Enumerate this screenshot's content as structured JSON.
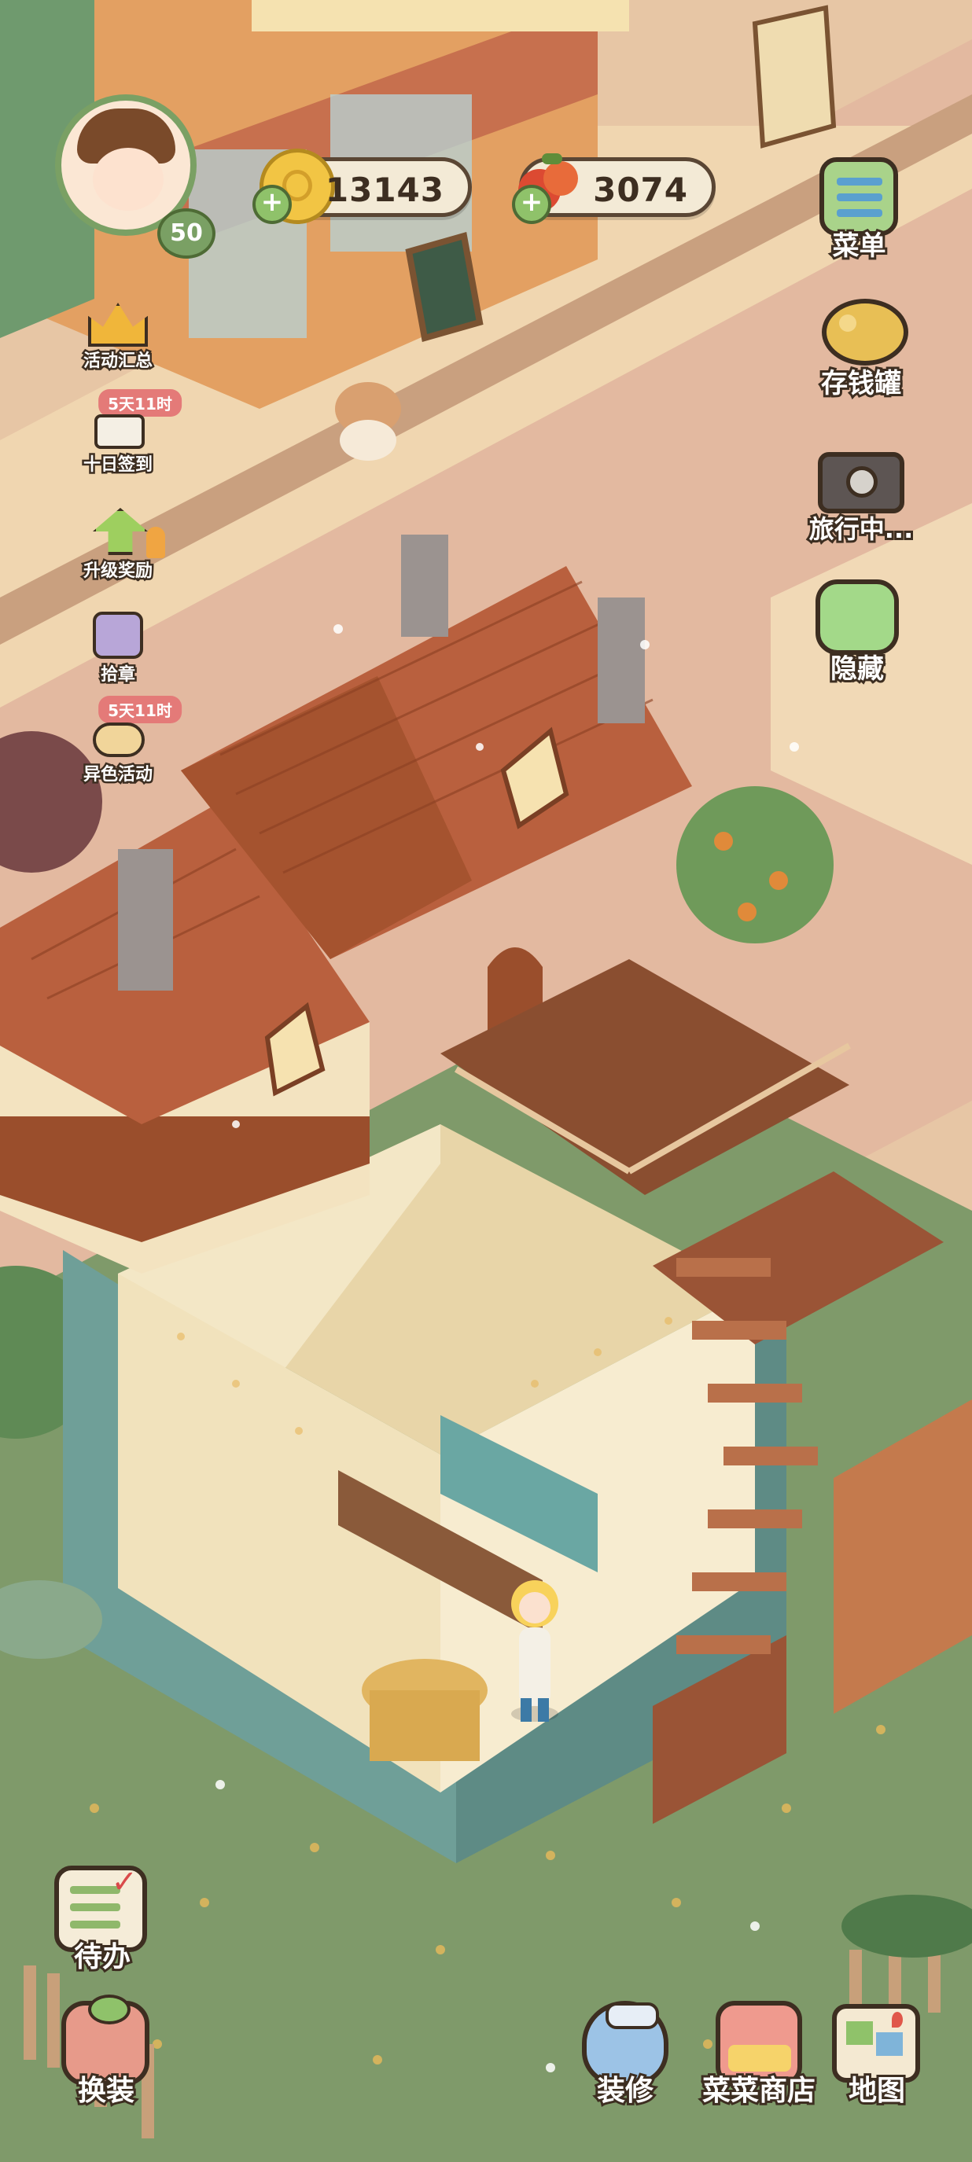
{
  "player": {
    "level": "50"
  },
  "currency": {
    "coins": "13143",
    "tomatoes": "3074"
  },
  "right_menu": {
    "menu": "菜单",
    "piggy_bank": "存钱罐",
    "travel": "旅行中...",
    "hide": "隐藏"
  },
  "left_menu": {
    "events_summary": "活动汇总",
    "ten_day_checkin": "十日签到",
    "ten_day_checkin_badge": "5天11时",
    "upgrade_rewards": "升级奖励",
    "pick_badge": "拾章",
    "alt_color_event": "异色活动",
    "alt_color_event_badge": "5天11时"
  },
  "bottom_bar": {
    "todo": "待办",
    "outfit": "换装",
    "decorate": "装修",
    "shop": "菜菜商店",
    "map": "地图"
  },
  "colors": {
    "grass": "#7f9a6a",
    "sidewalk": "#e8c8a6",
    "roof": "#b9603e",
    "wall_teal": "#6f9f98",
    "outline": "#3d2e21"
  }
}
